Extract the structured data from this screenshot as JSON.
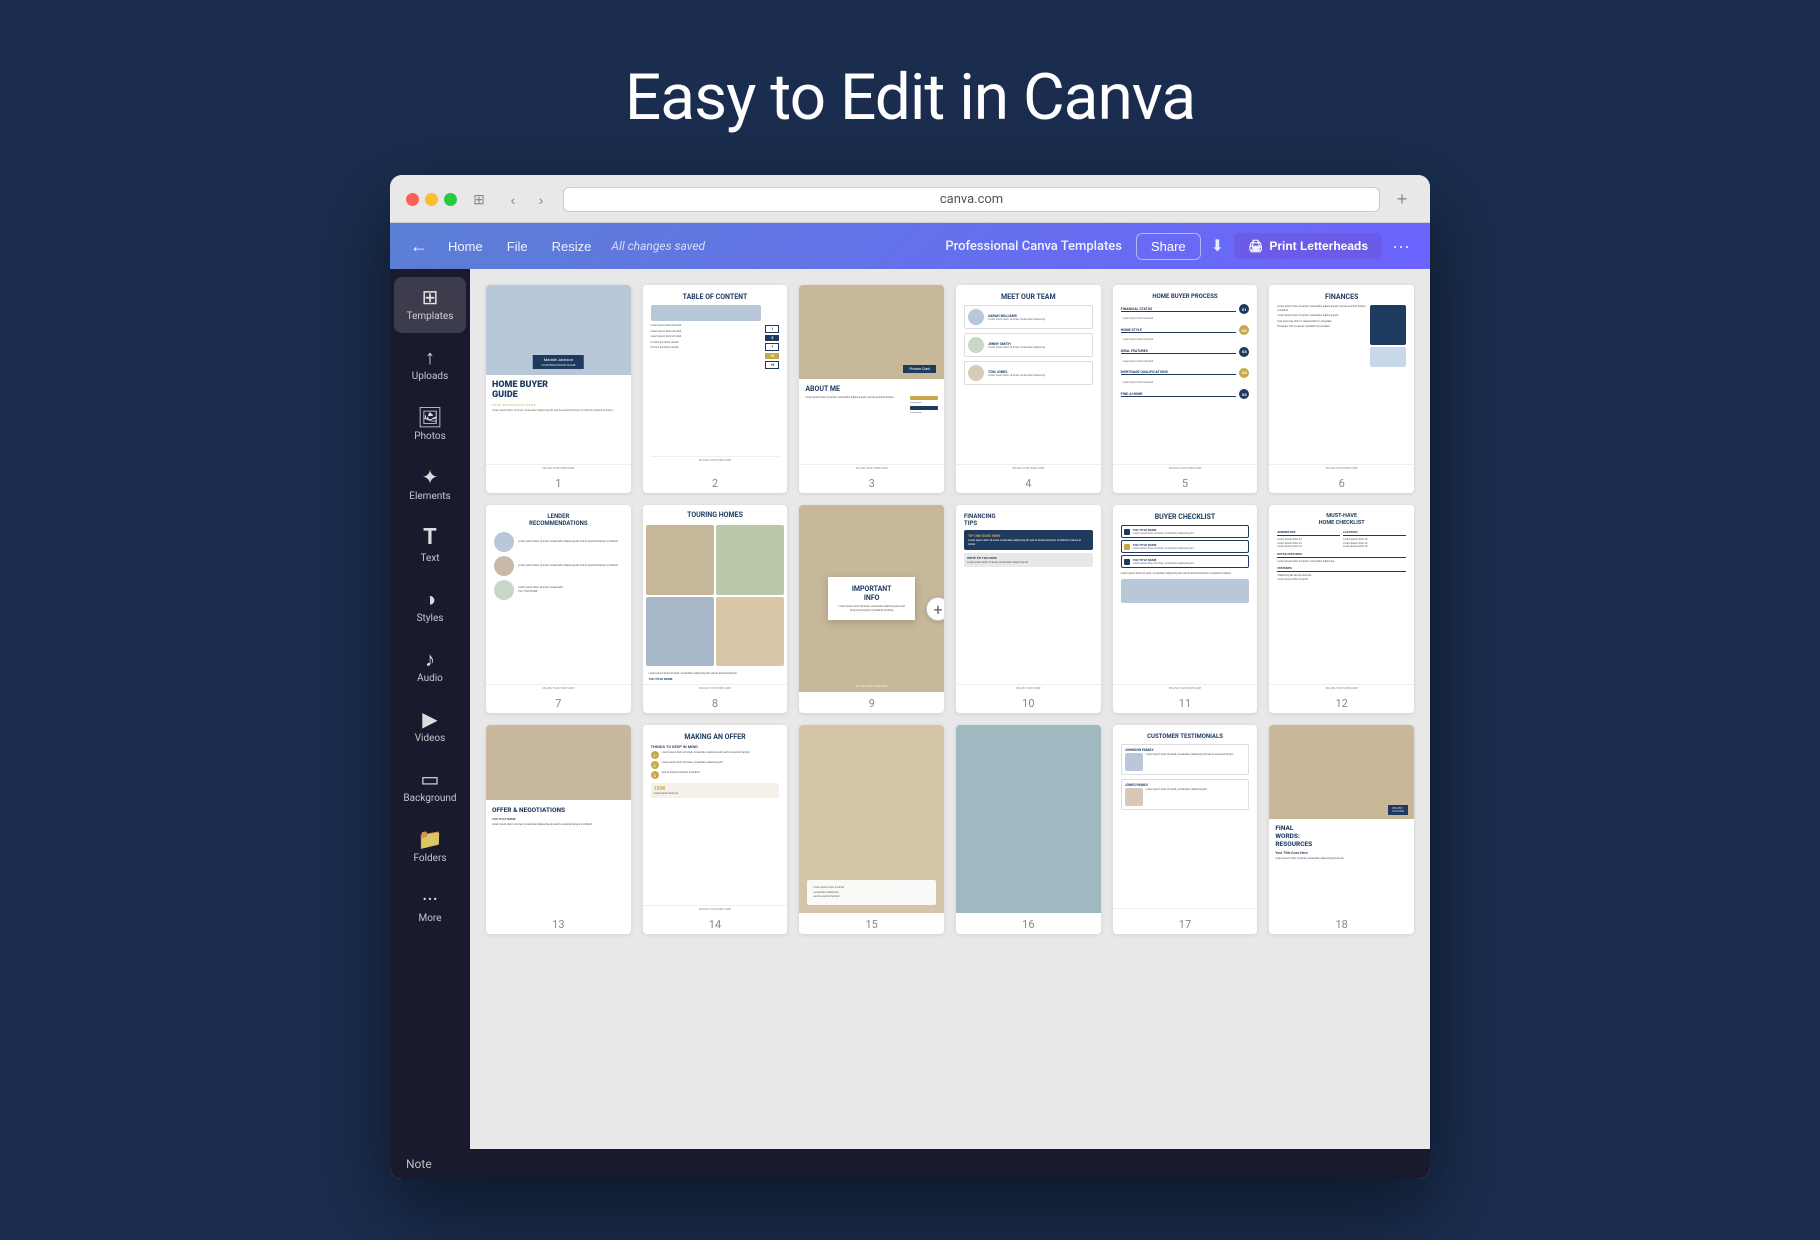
{
  "page": {
    "main_title": "Easy to Edit in Canva",
    "browser_url": "canva.com"
  },
  "browser": {
    "traffic_lights": [
      "red",
      "yellow",
      "green"
    ],
    "nav_back": "‹",
    "nav_forward": "›",
    "new_tab": "+",
    "window_btn": "⊞"
  },
  "toolbar": {
    "back_icon": "←",
    "home_label": "Home",
    "file_label": "File",
    "resize_label": "Resize",
    "status": "All changes saved",
    "design_title": "Professional Canva Templates",
    "share_label": "Share",
    "download_icon": "⬇",
    "print_label": "Print Letterheads",
    "more_icon": "···"
  },
  "sidebar": {
    "items": [
      {
        "id": "templates",
        "icon": "⊞",
        "label": "Templates",
        "active": true
      },
      {
        "id": "uploads",
        "icon": "↑",
        "label": "Uploads"
      },
      {
        "id": "photos",
        "icon": "🖼",
        "label": "Photos"
      },
      {
        "id": "elements",
        "icon": "✦",
        "label": "Elements"
      },
      {
        "id": "text",
        "icon": "T",
        "label": "Text"
      },
      {
        "id": "styles",
        "icon": "◑",
        "label": "Styles"
      },
      {
        "id": "audio",
        "icon": "♪",
        "label": "Audio"
      },
      {
        "id": "videos",
        "icon": "▶",
        "label": "Videos"
      },
      {
        "id": "background",
        "icon": "▭",
        "label": "Background"
      },
      {
        "id": "folders",
        "icon": "📁",
        "label": "Folders"
      },
      {
        "id": "more",
        "icon": "···",
        "label": "More"
      }
    ]
  },
  "pages": [
    {
      "num": 1,
      "title": "HOME BUYER GUIDE"
    },
    {
      "num": 2,
      "title": "TABLE OF CONTENT"
    },
    {
      "num": 3,
      "title": "ABOUT ME"
    },
    {
      "num": 4,
      "title": "MEET OUR TEAM"
    },
    {
      "num": 5,
      "title": "HOME BUYER PROCESS"
    },
    {
      "num": 6,
      "title": "FINANCES"
    },
    {
      "num": 7,
      "title": "LENDER RECOMMENDATIONS"
    },
    {
      "num": 8,
      "title": "TOURING HOMES"
    },
    {
      "num": 9,
      "title": "IMPORTANT INFO"
    },
    {
      "num": 10,
      "title": "FINANCING TIPS"
    },
    {
      "num": 11,
      "title": "BUYER CHECKLIST"
    },
    {
      "num": 12,
      "title": "MUST-HAVE HOME CHECKLIST"
    },
    {
      "num": 13,
      "title": "OFFER & NEGOTIATIONS"
    },
    {
      "num": 14,
      "title": "MAKING AN OFFER"
    },
    {
      "num": 15,
      "title": ""
    },
    {
      "num": 16,
      "title": ""
    },
    {
      "num": 17,
      "title": "CUSTOMER TESTIMONIALS"
    },
    {
      "num": 18,
      "title": "FINAL WORDS: RESOURCES"
    }
  ],
  "note_bar": {
    "label": "Note"
  }
}
